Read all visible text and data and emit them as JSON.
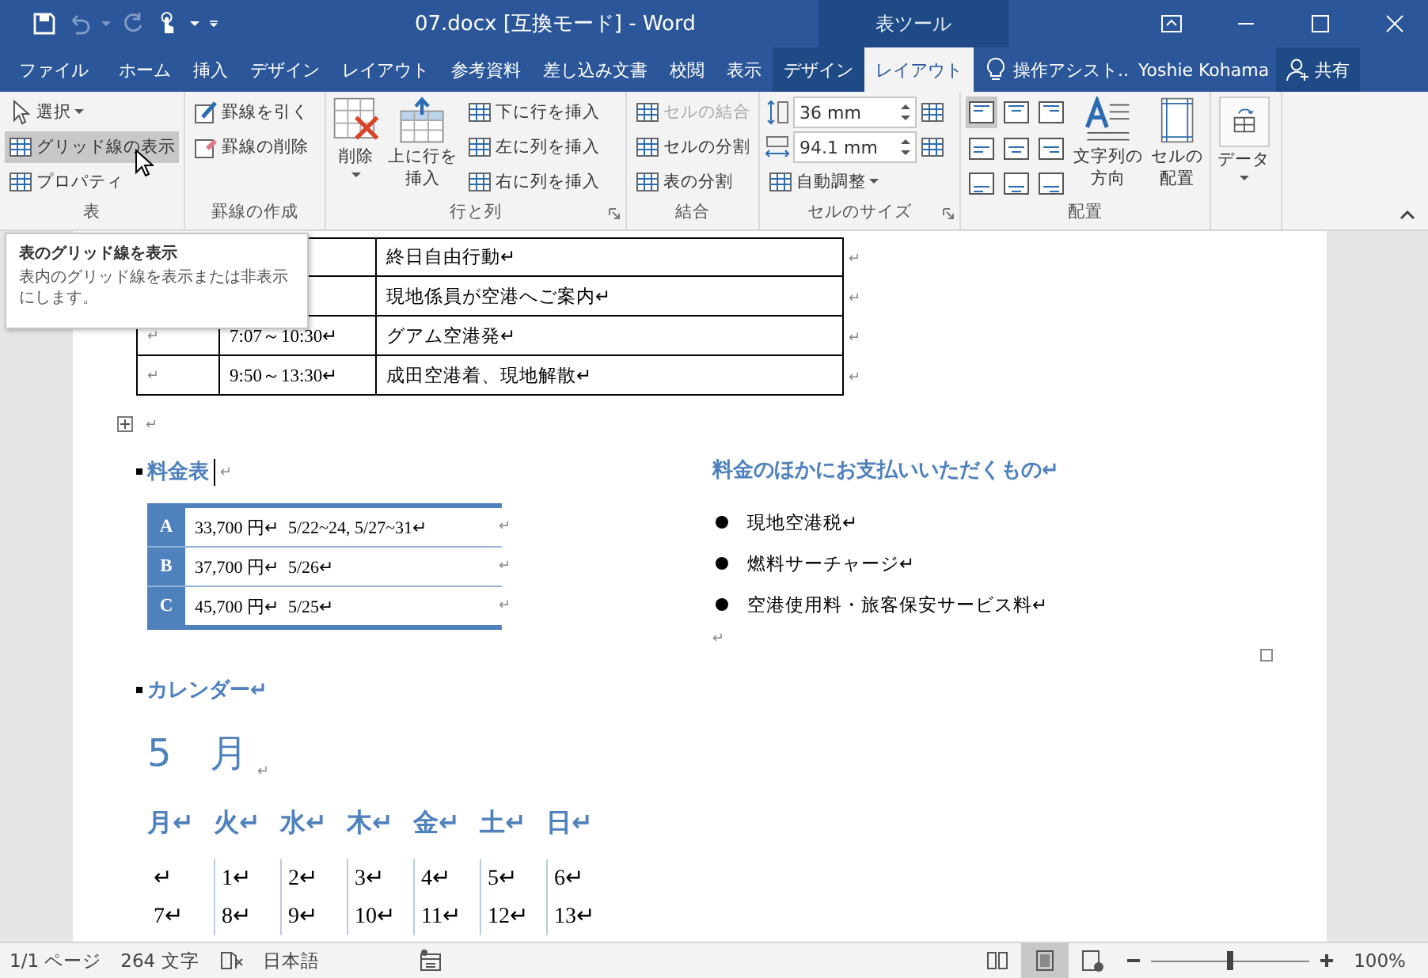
{
  "window": {
    "title": "07.docx [互換モード] - Word",
    "context_title": "表ツール"
  },
  "tabs": [
    {
      "label": "ファイル",
      "kind": "file",
      "selected": false
    },
    {
      "label": "ホーム",
      "kind": "standard",
      "selected": false
    },
    {
      "label": "挿入",
      "kind": "standard",
      "selected": false
    },
    {
      "label": "デザイン",
      "kind": "standard",
      "selected": false
    },
    {
      "label": "レイアウト",
      "kind": "standard",
      "selected": false
    },
    {
      "label": "参考資料",
      "kind": "standard",
      "selected": false
    },
    {
      "label": "差し込み文書",
      "kind": "standard",
      "selected": false
    },
    {
      "label": "校閲",
      "kind": "standard",
      "selected": false
    },
    {
      "label": "表示",
      "kind": "standard",
      "selected": false
    },
    {
      "label": "デザイン",
      "kind": "contextual",
      "selected": false
    },
    {
      "label": "レイアウト",
      "kind": "contextual",
      "selected": true
    }
  ],
  "tell_me": "操作アシスト..",
  "user": "Yoshie Kohama",
  "share": "共有",
  "ribbon": {
    "groups": [
      {
        "label": "表",
        "items": [
          {
            "label": "選択",
            "dropdown": true,
            "selected": false
          },
          {
            "label": "グリッド線の表示",
            "dropdown": false,
            "selected": true
          },
          {
            "label": "プロパティ",
            "dropdown": false,
            "selected": false
          }
        ]
      },
      {
        "label": "罫線の作成",
        "items": [
          {
            "label": "罫線を引く"
          },
          {
            "label": "罫線の削除"
          }
        ]
      },
      {
        "label": "行と列",
        "large": [
          {
            "lines": [
              "削除"
            ],
            "dropdown": true
          },
          {
            "lines": [
              "上に行を",
              "挿入"
            ],
            "dropdown": false
          }
        ],
        "items": [
          {
            "label": "下に行を挿入"
          },
          {
            "label": "左に列を挿入"
          },
          {
            "label": "右に列を挿入"
          }
        ]
      },
      {
        "label": "結合",
        "items": [
          {
            "label": "セルの結合",
            "disabled": true
          },
          {
            "label": "セルの分割",
            "disabled": false
          },
          {
            "label": "表の分割",
            "disabled": false
          }
        ]
      },
      {
        "label": "セルのサイズ",
        "fields": [
          {
            "value": "36 mm"
          },
          {
            "value": "94.1 mm"
          }
        ],
        "items": [
          {
            "label": "自動調整",
            "dropdown": true
          }
        ]
      },
      {
        "label": "配置",
        "alignments": [
          {
            "selected": true
          },
          {
            "selected": false
          },
          {
            "selected": false
          },
          {
            "selected": false
          },
          {
            "selected": false
          },
          {
            "selected": false
          },
          {
            "selected": false
          },
          {
            "selected": false
          },
          {
            "selected": false
          }
        ],
        "large": [
          {
            "lines": [
              "文字列の",
              "方向"
            ],
            "dropdown": false
          },
          {
            "lines": [
              "セルの",
              "配置"
            ],
            "dropdown": false
          }
        ]
      },
      {
        "large": [
          {
            "lines": [
              "データ"
            ],
            "dropdown": true
          }
        ]
      }
    ]
  },
  "tooltip": {
    "title": "表のグリッド線を表示",
    "body": "表内のグリッド線を表示または非表示にします。"
  },
  "document": {
    "schedule_rows": [
      {
        "activity": "終日自由行動↵",
        "row_end": "↵"
      },
      {
        "activity": "現地係員が空港へご案内↵",
        "row_end": "↵"
      },
      {
        "mark": "↵",
        "time": "7:07～10:30↵",
        "activity": "グアム空港発↵",
        "row_end": "↵"
      },
      {
        "mark": "↵",
        "time": "9:50～13:30↵",
        "activity": "成田空港着、現地解散↵",
        "row_end": "↵"
      }
    ],
    "after_table_mark": "↵",
    "price_heading": "料金表",
    "price_heading_mark": "↵",
    "prices": [
      {
        "label": "A",
        "price": "33,700 円↵",
        "dates": "5/22~24, 5/27~31↵",
        "row_end": "↵"
      },
      {
        "label": "B",
        "price": "37,700 円↵",
        "dates": "5/26↵",
        "row_end": "↵"
      },
      {
        "label": "C",
        "price": "45,700 円↵",
        "dates": "5/25↵",
        "row_end": "↵"
      }
    ],
    "extras_heading": "料金のほかにお支払いいただくもの↵",
    "extras": [
      "現地空港税↵",
      "燃料サーチャージ↵",
      "空港使用料・旅客保安サービス料↵"
    ],
    "extras_end": "↵",
    "calendar_heading": "カレンダー↵",
    "month": "5　月",
    "month_mark": "↵",
    "weekdays": [
      "月↵",
      "火↵",
      "水↵",
      "木↵",
      "金↵",
      "土↵",
      "日↵"
    ],
    "weeks": [
      [
        "↵",
        "1↵",
        "2↵",
        "3↵",
        "4↵",
        "5↵",
        "6↵"
      ],
      [
        "7↵",
        "8↵",
        "9↵",
        "10↵",
        "11↵",
        "12↵",
        "13↵"
      ]
    ]
  },
  "status": {
    "page": "1/1 ページ",
    "words": "264 文字",
    "language": "日本語",
    "views": [
      {
        "selected": false
      },
      {
        "selected": true
      },
      {
        "selected": false
      }
    ],
    "zoom": {
      "level": 0.5,
      "reading": "100%"
    }
  }
}
